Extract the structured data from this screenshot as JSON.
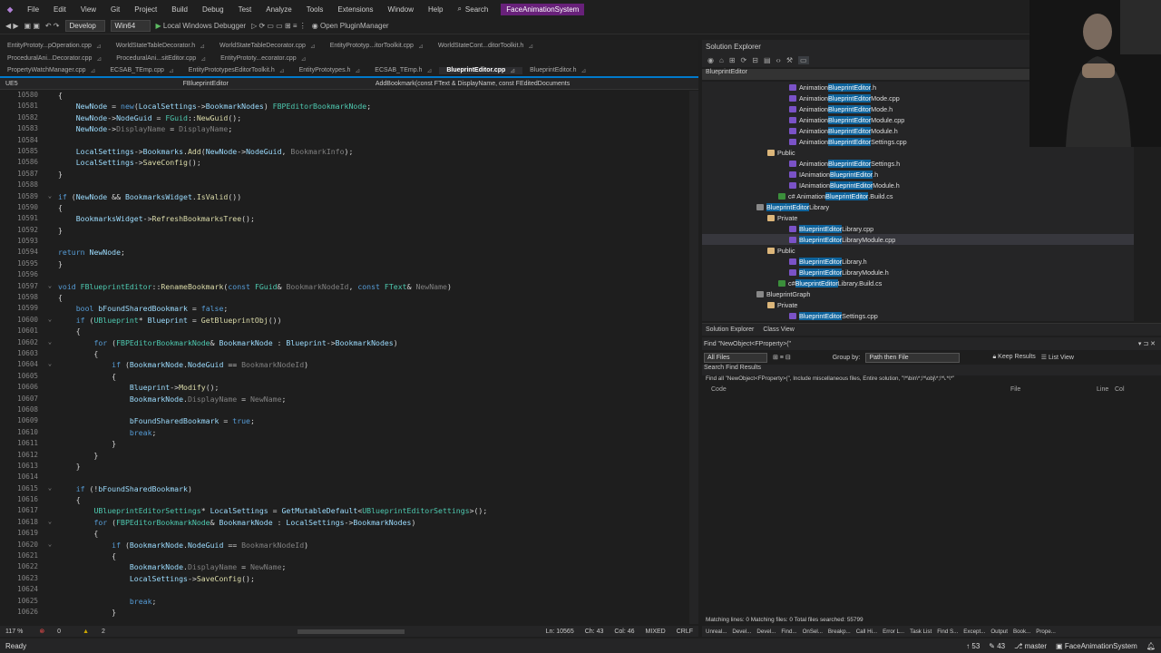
{
  "menu": {
    "items": [
      "File",
      "Edit",
      "View",
      "Git",
      "Project",
      "Build",
      "Debug",
      "Test",
      "Analyze",
      "Tools",
      "Extensions",
      "Window",
      "Help"
    ],
    "search": "Search",
    "solution": "FaceAnimationSystem"
  },
  "toolbar": {
    "config": "Develop",
    "platform": "Win64",
    "debugger": "Local Windows Debugger",
    "plugin": "Open PluginManager"
  },
  "tabs_row1": [
    "EntityPrototy...pOperation.cpp",
    "WorldStateTableDecorator.h",
    "WorldStateTableDecorator.cpp",
    "EntityPrototyp...itorToolkit.cpp",
    "WorldStateCont...ditorToolkit.h"
  ],
  "tabs_row1b": [
    "ProceduralAni...Decorator.cpp",
    "ProceduralAni...sitEditor.cpp",
    "EntityPrototy...ecorator.cpp"
  ],
  "tabs_row2": [
    "PropertyWatchManager.cpp",
    "ECSAB_TEmp.cpp",
    "EntityPrototypesEditorToolkit.h",
    "EntityPrototypes.h",
    "ECSAB_TEmp.h",
    "BlueprintEditor.cpp",
    "BlueprintEditor.h"
  ],
  "active_tab": "BlueprintEditor.cpp",
  "nav": {
    "project": "UE5",
    "scope": "FBlueprintEditor",
    "member": "AddBookmark(const FText & DisplayName, const FEditedDocuments"
  },
  "code_lines": [
    {
      "n": "10580",
      "f": "",
      "t": "{"
    },
    {
      "n": "10581",
      "f": "",
      "t": "    NewNode = new(LocalSettings->BookmarkNodes) FBPEditorBookmarkNode;"
    },
    {
      "n": "10582",
      "f": "",
      "t": "    NewNode->NodeGuid = FGuid::NewGuid();"
    },
    {
      "n": "10583",
      "f": "",
      "t": "    NewNode->DisplayName = DisplayName;"
    },
    {
      "n": "10584",
      "f": "",
      "t": ""
    },
    {
      "n": "10585",
      "f": "",
      "t": "    LocalSettings->Bookmarks.Add(NewNode->NodeGuid, BookmarkInfo);"
    },
    {
      "n": "10586",
      "f": "",
      "t": "    LocalSettings->SaveConfig();"
    },
    {
      "n": "10587",
      "f": "",
      "t": "}"
    },
    {
      "n": "10588",
      "f": "",
      "t": ""
    },
    {
      "n": "10589",
      "f": "v",
      "t": "if (NewNode && BookmarksWidget.IsValid())"
    },
    {
      "n": "10590",
      "f": "",
      "t": "{"
    },
    {
      "n": "10591",
      "f": "",
      "t": "    BookmarksWidget->RefreshBookmarksTree();"
    },
    {
      "n": "10592",
      "f": "",
      "t": "}"
    },
    {
      "n": "10593",
      "f": "",
      "t": ""
    },
    {
      "n": "10594",
      "f": "",
      "t": "return NewNode;"
    },
    {
      "n": "10595",
      "f": "",
      "t": "}"
    },
    {
      "n": "10596",
      "f": "",
      "t": ""
    },
    {
      "n": "10597",
      "f": "v",
      "t": "void FBlueprintEditor::RenameBookmark(const FGuid& BookmarkNodeId, const FText& NewName)"
    },
    {
      "n": "10598",
      "f": "",
      "t": "{"
    },
    {
      "n": "10599",
      "f": "",
      "t": "    bool bFoundSharedBookmark = false;"
    },
    {
      "n": "10600",
      "f": "v",
      "t": "    if (UBlueprint* Blueprint = GetBlueprintObj())"
    },
    {
      "n": "10601",
      "f": "",
      "t": "    {"
    },
    {
      "n": "10602",
      "f": "v",
      "t": "        for (FBPEditorBookmarkNode& BookmarkNode : Blueprint->BookmarkNodes)"
    },
    {
      "n": "10603",
      "f": "",
      "t": "        {"
    },
    {
      "n": "10604",
      "f": "v",
      "t": "            if (BookmarkNode.NodeGuid == BookmarkNodeId)"
    },
    {
      "n": "10605",
      "f": "",
      "t": "            {"
    },
    {
      "n": "10606",
      "f": "",
      "t": "                Blueprint->Modify();"
    },
    {
      "n": "10607",
      "f": "",
      "t": "                BookmarkNode.DisplayName = NewName;"
    },
    {
      "n": "10608",
      "f": "",
      "t": ""
    },
    {
      "n": "10609",
      "f": "",
      "t": "                bFoundSharedBookmark = true;"
    },
    {
      "n": "10610",
      "f": "",
      "t": "                break;"
    },
    {
      "n": "10611",
      "f": "",
      "t": "            }"
    },
    {
      "n": "10612",
      "f": "",
      "t": "        }"
    },
    {
      "n": "10613",
      "f": "",
      "t": "    }"
    },
    {
      "n": "10614",
      "f": "",
      "t": ""
    },
    {
      "n": "10615",
      "f": "v",
      "t": "    if (!bFoundSharedBookmark)"
    },
    {
      "n": "10616",
      "f": "",
      "t": "    {"
    },
    {
      "n": "10617",
      "f": "",
      "t": "        UBlueprintEditorSettings* LocalSettings = GetMutableDefault<UBlueprintEditorSettings>();"
    },
    {
      "n": "10618",
      "f": "v",
      "t": "        for (FBPEditorBookmarkNode& BookmarkNode : LocalSettings->BookmarkNodes)"
    },
    {
      "n": "10619",
      "f": "",
      "t": "        {"
    },
    {
      "n": "10620",
      "f": "v",
      "t": "            if (BookmarkNode.NodeGuid == BookmarkNodeId)"
    },
    {
      "n": "10621",
      "f": "",
      "t": "            {"
    },
    {
      "n": "10622",
      "f": "",
      "t": "                BookmarkNode.DisplayName = NewName;"
    },
    {
      "n": "10623",
      "f": "",
      "t": "                LocalSettings->SaveConfig();"
    },
    {
      "n": "10624",
      "f": "",
      "t": ""
    },
    {
      "n": "10625",
      "f": "",
      "t": "                break;"
    },
    {
      "n": "10626",
      "f": "",
      "t": "            }"
    }
  ],
  "editor_status": {
    "zoom": "117 %",
    "errors": "0",
    "warnings": "2",
    "ln": "Ln: 10565",
    "ch": "Ch: 43",
    "col": "Col: 46",
    "mixed": "MIXED",
    "crlf": "CRLF"
  },
  "solution_explorer": {
    "title": "Solution Explorer",
    "search_label": "BlueprintEditor",
    "tree": [
      {
        "indent": 8,
        "pre": "Animation",
        "hl": "BlueprintEditor",
        "post": ".h",
        "icon": "#7a52c7"
      },
      {
        "indent": 8,
        "pre": "Animation",
        "hl": "BlueprintEditor",
        "post": "Mode.cpp",
        "icon": "#7a52c7"
      },
      {
        "indent": 8,
        "pre": "Animation",
        "hl": "BlueprintEditor",
        "post": "Mode.h",
        "icon": "#7a52c7"
      },
      {
        "indent": 8,
        "pre": "Animation",
        "hl": "BlueprintEditor",
        "post": "Module.cpp",
        "icon": "#7a52c7"
      },
      {
        "indent": 8,
        "pre": "Animation",
        "hl": "BlueprintEditor",
        "post": "Module.h",
        "icon": "#7a52c7"
      },
      {
        "indent": 8,
        "pre": "Animation",
        "hl": "BlueprintEditor",
        "post": "Settings.cpp",
        "icon": "#7a52c7"
      },
      {
        "indent": 6,
        "pre": "Public",
        "hl": "",
        "post": "",
        "icon": "#dcb67a"
      },
      {
        "indent": 8,
        "pre": "Animation",
        "hl": "BlueprintEditor",
        "post": "Settings.h",
        "icon": "#7a52c7"
      },
      {
        "indent": 8,
        "pre": "IAnimation",
        "hl": "BlueprintEditor",
        "post": ".h",
        "icon": "#7a52c7"
      },
      {
        "indent": 8,
        "pre": "IAnimation",
        "hl": "BlueprintEditor",
        "post": "Module.h",
        "icon": "#7a52c7"
      },
      {
        "indent": 7,
        "pre": "c# Animation",
        "hl": "BlueprintEditor",
        "post": ".Build.cs",
        "icon": "#3b8f3b"
      },
      {
        "indent": 5,
        "pre": "",
        "hl": "BlueprintEditor",
        "post": "Library",
        "icon": "#888888"
      },
      {
        "indent": 6,
        "pre": "Private",
        "hl": "",
        "post": "",
        "icon": "#dcb67a"
      },
      {
        "indent": 8,
        "pre": "",
        "hl": "BlueprintEditor",
        "post": "Library.cpp",
        "icon": "#7a52c7"
      },
      {
        "indent": 8,
        "pre": "",
        "hl": "BlueprintEditor",
        "post": "LibraryModule.cpp",
        "icon": "#7a52c7",
        "sel": true
      },
      {
        "indent": 6,
        "pre": "Public",
        "hl": "",
        "post": "",
        "icon": "#dcb67a"
      },
      {
        "indent": 8,
        "pre": "",
        "hl": "BlueprintEditor",
        "post": "Library.h",
        "icon": "#7a52c7"
      },
      {
        "indent": 8,
        "pre": "",
        "hl": "BlueprintEditor",
        "post": "LibraryModule.h",
        "icon": "#7a52c7"
      },
      {
        "indent": 7,
        "pre": "c#",
        "hl": "BlueprintEditor",
        "post": "Library.Build.cs",
        "icon": "#3b8f3b"
      },
      {
        "indent": 5,
        "pre": "BlueprintGraph",
        "hl": "",
        "post": "",
        "icon": "#888888"
      },
      {
        "indent": 6,
        "pre": "Private",
        "hl": "",
        "post": "",
        "icon": "#dcb67a"
      },
      {
        "indent": 8,
        "pre": "",
        "hl": "BlueprintEditor",
        "post": "Settings.cpp",
        "icon": "#7a52c7"
      }
    ],
    "tabs": [
      "Solution Explorer",
      "Class View"
    ]
  },
  "find": {
    "title": "Find \"NewObject<FProperty>(\"",
    "scope": "All Files",
    "group_label": "Group by:",
    "group": "Path then File",
    "keep": "Keep Results",
    "list": "List View",
    "search_label": "Search Find Results",
    "summary": "Find all \"NewObject<FProperty>(\", Include miscellaneous files, Entire solution, \"!*\\bin\\*;!*\\obj\\*;!*\\.*\\*\"",
    "cols": [
      "Code",
      "File",
      "Line",
      "Col"
    ],
    "footer": "Matching lines: 0 Matching files: 0 Total files searched: 55799"
  },
  "bottom_tabs": [
    "Unreal...",
    "Devel...",
    "Devel...",
    "Find...",
    "OnSel...",
    "Breakp...",
    "Call Hi...",
    "Error L...",
    "Task List",
    "Find S...",
    "Except...",
    "Output",
    "Book...",
    "Prope..."
  ],
  "status": {
    "ready": "Ready",
    "up": "53",
    "pencil": "43",
    "branch": "master",
    "solution": "FaceAnimationSystem"
  },
  "colors": {
    "accent": "#007acc",
    "selection_highlight": "#0e639c",
    "solution_badge": "#68217a"
  }
}
